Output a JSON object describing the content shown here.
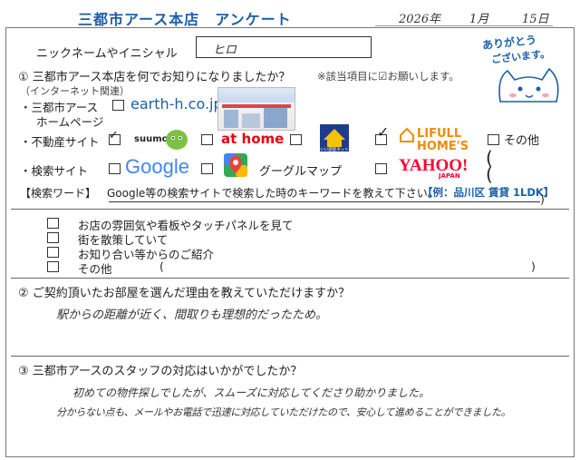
{
  "header": {
    "title": "三都市アース本店　アンケート",
    "date": {
      "year": "2026年",
      "month": "1月",
      "day": "15日"
    },
    "thanks": {
      "line1": "ありがとう",
      "line2": "ございます。"
    }
  },
  "nickname": {
    "label": "ニックネームやイニシャル",
    "value": "ヒロ"
  },
  "q1": {
    "question": "① 三都市アース本店を何でお知りになりましたか？",
    "note": "※該当項目に☑お願いします。",
    "internet_heading": "（インターネット関連）",
    "homepage": {
      "label_line1": "・三都市アース",
      "label_line2": "ホームページ",
      "url": "earth-h.co.jp",
      "checked": false
    },
    "realestate": {
      "label": "・不動産サイト",
      "options": [
        {
          "name": "suumo",
          "checked": true
        },
        {
          "name": "at home",
          "checked": false
        },
        {
          "name": "いい部屋ネット",
          "checked": false
        },
        {
          "name": "LIFULL HOME'S",
          "checked": true
        },
        {
          "name": "その他",
          "checked": false
        }
      ],
      "other_paren": "(　　　　　)"
    },
    "search": {
      "label": "・検索サイト",
      "options": [
        {
          "name": "Google",
          "checked": false
        },
        {
          "name": "グーグルマップ",
          "checked": false
        },
        {
          "name": "YAHOO!",
          "sub": "JAPAN",
          "checked": false
        }
      ],
      "other_paren": "(　　　　　)"
    },
    "keyword": {
      "label": "【検索ワード】",
      "text": "Google等の検索サイトで検索した時のキーワードを教えて下さい。",
      "example": "【例：品川区 賃貸 1LDK】",
      "close_paren": ")"
    },
    "offline": [
      {
        "label": "お店の雰囲気や看板やタッチパネルを見て",
        "checked": false
      },
      {
        "label": "街を散策していて",
        "checked": false
      },
      {
        "label": "お知り合い等からのご紹介",
        "checked": false
      },
      {
        "label": "その他",
        "checked": false,
        "paren_open": "(",
        "paren_close": ")"
      }
    ]
  },
  "q2": {
    "question": "② ご契約頂いたお部屋を選んだ理由を教えていただけますか？",
    "answer": "駅からの距離が近く、間取りも理想的だったため。"
  },
  "q3": {
    "question": "③ 三都市アースのスタッフの対応はいかがでしたか？",
    "answer_line1": "初めての物件探しでしたが、スムーズに対応してくださり助かりました。",
    "answer_line2": "分からない点も、メールやお電話で迅速に対応していただけたので、安心して進めることができました。"
  },
  "colors": {
    "accent": "#1b5fa8",
    "google_blue": "#4285f4",
    "google_red": "#ea4335",
    "google_yellow": "#fbbc05",
    "google_green": "#34a853",
    "athome_red": "#e60012",
    "homes_orange": "#f08c00",
    "yahoo_red": "#ff0033",
    "suumo_green": "#7cc242"
  }
}
